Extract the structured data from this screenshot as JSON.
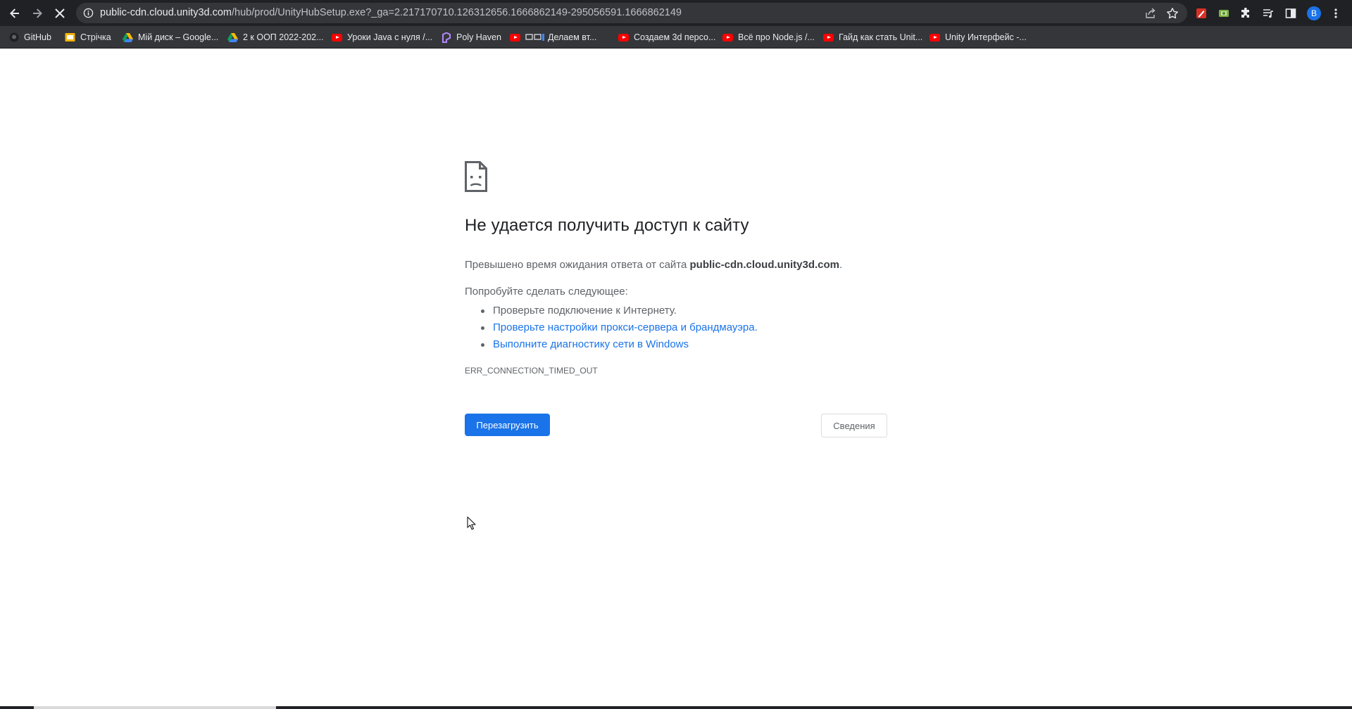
{
  "browser": {
    "url_host": "public-cdn.cloud.unity3d.com",
    "url_path": "/hub/prod/UnityHubSetup.exe?_ga=2.217170710.126312656.1666862149-295056591.1666862149",
    "profile_initial": "B",
    "icons": [
      "back-arrow-icon",
      "forward-arrow-icon",
      "stop-loading-icon",
      "info-icon",
      "share-icon",
      "star-icon",
      "extensions-icon",
      "media-controls-icon",
      "side-panel-icon",
      "menu-icon"
    ]
  },
  "bookmarks": [
    {
      "label": "GitHub",
      "icon": "github-icon"
    },
    {
      "label": "Стрічка",
      "icon": "folder-icon"
    },
    {
      "label": "Мій диск – Google...",
      "icon": "google-drive-icon"
    },
    {
      "label": "2 к ООП 2022-202...",
      "icon": "google-drive-icon"
    },
    {
      "label": "Уроки Java с нуля /...",
      "icon": "youtube-icon"
    },
    {
      "label": "Poly Haven",
      "icon": "polyhaven-icon"
    },
    {
      "label": "Делаем вт...",
      "icon": "youtube-icon"
    },
    {
      "label": "Создаем 3d персо...",
      "icon": "youtube-icon"
    },
    {
      "label": "Всё про Node.js /...",
      "icon": "youtube-icon"
    },
    {
      "label": "Гайд как стать Unit...",
      "icon": "youtube-icon"
    },
    {
      "label": "Unity Интерфейс -...",
      "icon": "youtube-icon"
    }
  ],
  "error_page": {
    "title": "Не удается получить доступ к сайту",
    "summary_prefix": "Превышено время ожидания ответа от сайта ",
    "summary_host": "public-cdn.cloud.unity3d.com",
    "summary_suffix": ".",
    "try_heading": "Попробуйте сделать следующее:",
    "suggestions": [
      {
        "text": "Проверьте подключение к Интернету.",
        "link": false
      },
      {
        "text": "Проверьте настройки прокси-сервера и брандмауэра.",
        "link": true
      },
      {
        "text": "Выполните диагностику сети в Windows",
        "link": true
      }
    ],
    "error_code": "ERR_CONNECTION_TIMED_OUT",
    "reload_label": "Перезагрузить",
    "details_label": "Сведения"
  },
  "colors": {
    "chrome_dark": "#202124",
    "toolbar": "#35363a",
    "link_blue": "#1a73e8",
    "body_text": "#5f6368",
    "title_text": "#202124"
  }
}
